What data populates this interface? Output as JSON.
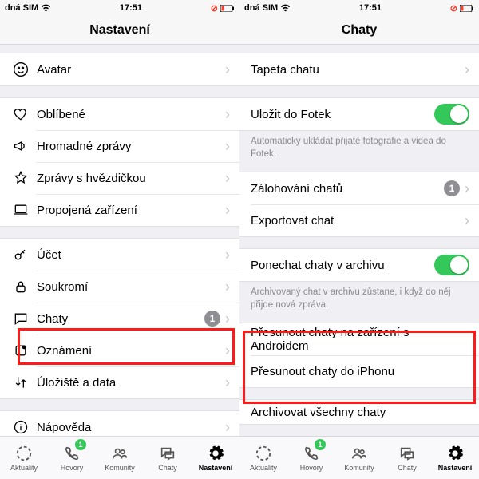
{
  "left": {
    "status": {
      "carrier": "dná SIM",
      "wifi": true,
      "time": "17:51",
      "right_icon": "low-signal"
    },
    "title": "Nastavení",
    "g1": [
      {
        "icon": "avatar",
        "label": "Avatar"
      }
    ],
    "g2": [
      {
        "icon": "heart",
        "label": "Oblíbené"
      },
      {
        "icon": "horn",
        "label": "Hromadné zprávy"
      },
      {
        "icon": "star",
        "label": "Zprávy s hvězdičkou"
      },
      {
        "icon": "laptop",
        "label": "Propojená zařízení"
      }
    ],
    "g3": [
      {
        "icon": "key",
        "label": "Účet"
      },
      {
        "icon": "lock",
        "label": "Soukromí"
      },
      {
        "icon": "bubble",
        "label": "Chaty",
        "badge": "1",
        "hl": true
      },
      {
        "icon": "bell",
        "label": "Oznámení"
      },
      {
        "icon": "updown",
        "label": "Úložiště a data"
      }
    ],
    "g4": [
      {
        "icon": "info",
        "label": "Nápověda"
      }
    ]
  },
  "right": {
    "status": {
      "carrier": "dná SIM",
      "wifi": true,
      "time": "17:51",
      "right_icon": "low-signal"
    },
    "title": "Chaty",
    "g1": [
      {
        "label": "Tapeta chatu"
      }
    ],
    "g2_row": {
      "label": "Uložit do Fotek",
      "toggle": true
    },
    "g2_note": "Automaticky ukládat přijaté fotografie a videa do Fotek.",
    "g3": [
      {
        "label": "Zálohování chatů",
        "badge": "1"
      },
      {
        "label": "Exportovat chat"
      }
    ],
    "g4_row": {
      "label": "Ponechat chaty v archivu",
      "toggle": true
    },
    "g4_note": "Archivovaný chat v archivu zůstane, i když do něj přijde nová zpráva.",
    "g5": [
      {
        "label": "Přesunout chaty na zařízení s Androidem",
        "link": true
      },
      {
        "label": "Přesunout chaty do iPhonu",
        "link": true
      }
    ],
    "g6": [
      {
        "label": "Archivovat všechny chaty",
        "link": true
      }
    ]
  },
  "tabs": [
    {
      "icon": "status",
      "label": "Aktuality"
    },
    {
      "icon": "phone",
      "label": "Hovory",
      "badge": "1"
    },
    {
      "icon": "people",
      "label": "Komunity"
    },
    {
      "icon": "bubble",
      "label": "Chaty"
    },
    {
      "icon": "gear",
      "label": "Nastavení",
      "active": true
    }
  ],
  "colors": {
    "accent": "#0b8f6f",
    "toggle": "#34c759",
    "highlight": "#ff1a1a"
  }
}
